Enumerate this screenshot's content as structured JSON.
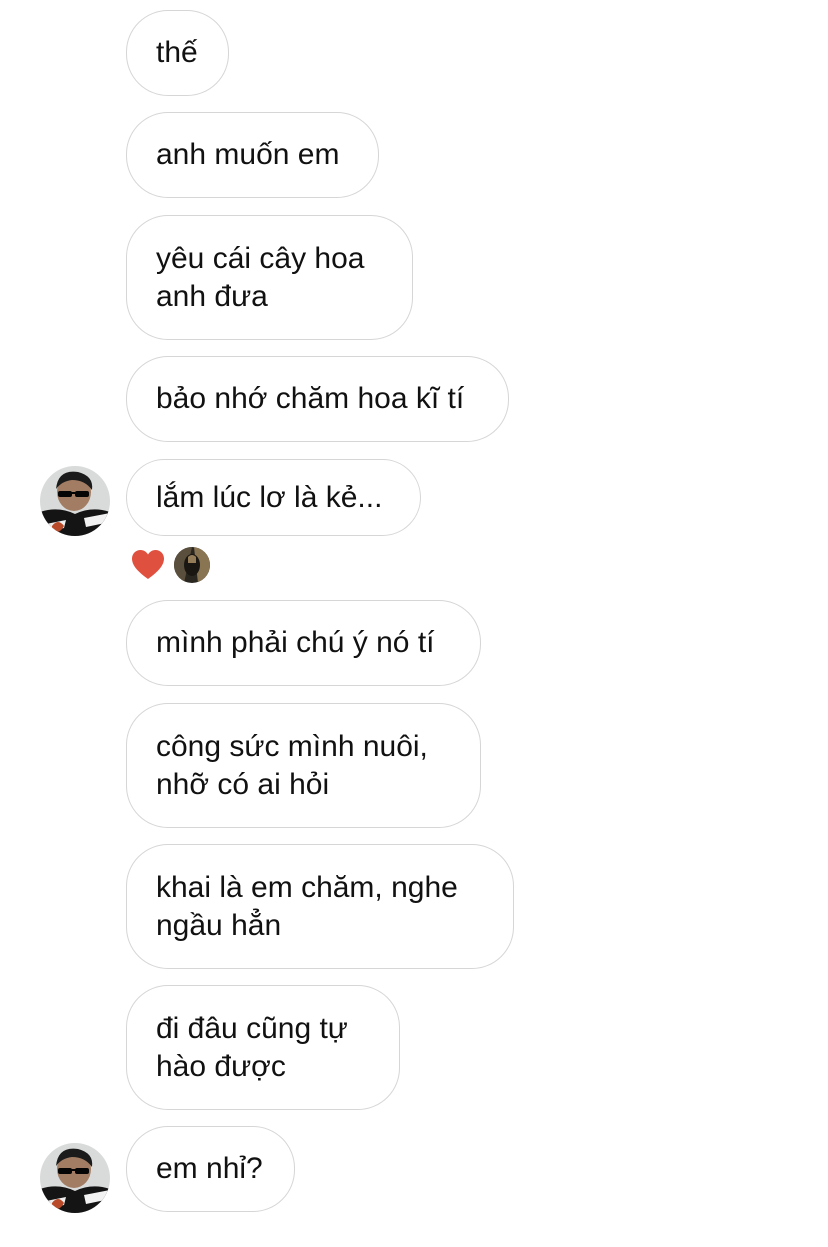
{
  "messages": [
    {
      "text": "thế"
    },
    {
      "text": "anh muốn em"
    },
    {
      "text": "yêu cái cây hoa\nanh đưa"
    },
    {
      "text": "bảo nhớ chăm hoa kĩ tí"
    },
    {
      "text": "lắm lúc lơ là kẻ..."
    },
    {
      "text": "mình phải chú ý nó tí"
    },
    {
      "text": "công sức mình nuôi,\nnhỡ có ai hỏi"
    },
    {
      "text": "khai là em chăm, nghe\nngầu hẳn"
    },
    {
      "text": "đi đâu cũng tự\nhào được"
    },
    {
      "text": "em nhỉ?"
    }
  ],
  "reaction": {
    "icon": "heart-icon",
    "color": "#e0503f"
  },
  "colors": {
    "bubble_border": "#d6d6d6",
    "text": "#111111",
    "background": "#ffffff"
  }
}
